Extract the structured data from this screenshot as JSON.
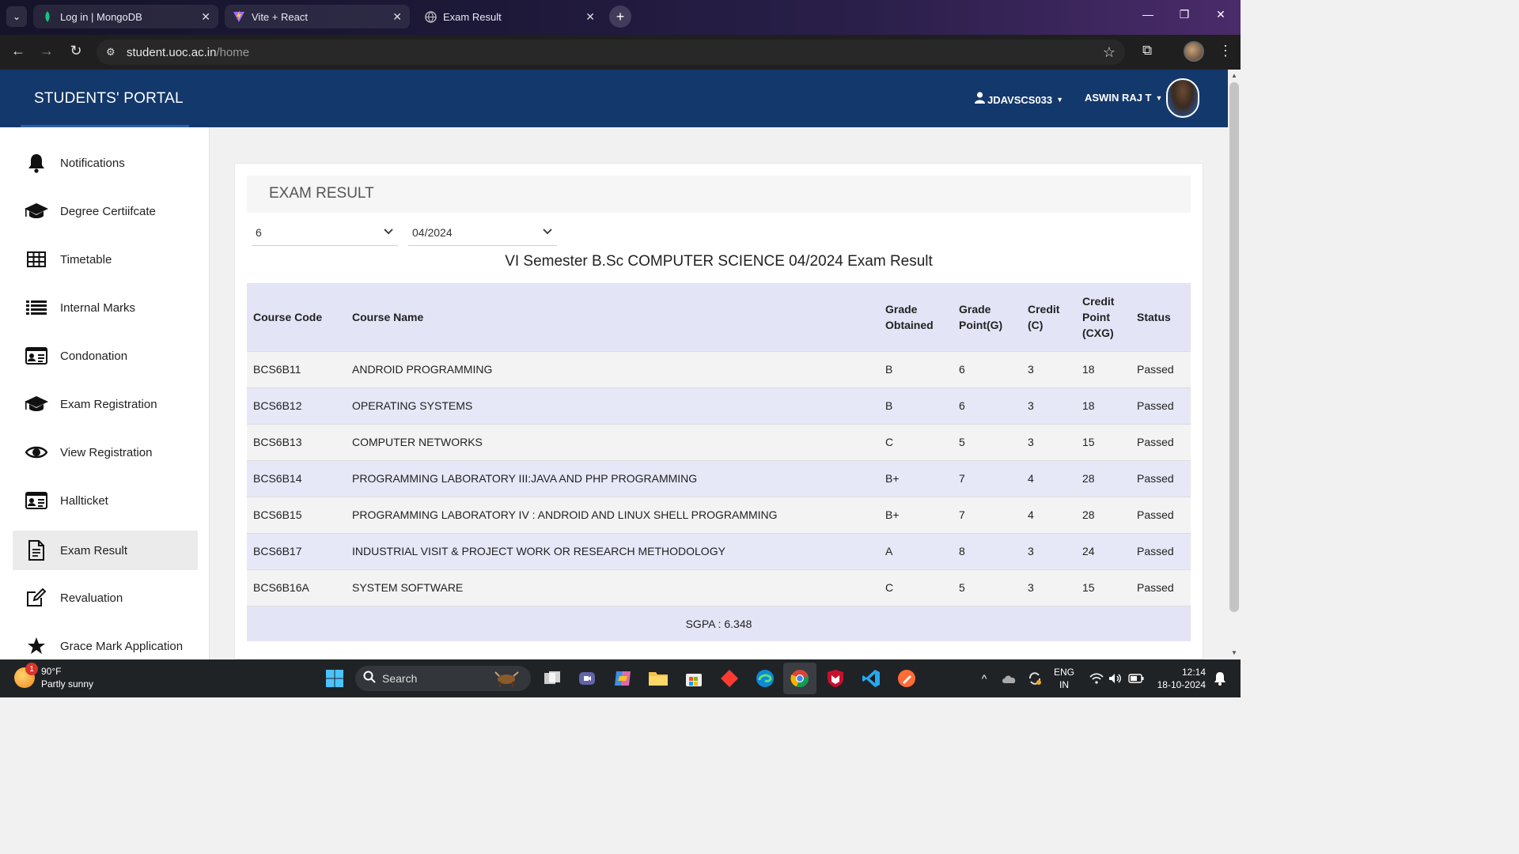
{
  "browser": {
    "tabs": [
      {
        "title": "Log in | MongoDB",
        "icon": "mongodb-leaf-icon",
        "active": false
      },
      {
        "title": "Vite + React",
        "icon": "vite-icon",
        "active": false
      },
      {
        "title": "Exam Result",
        "icon": "globe-icon",
        "active": true
      }
    ],
    "url_host": "student.uoc.ac.in",
    "url_path": "/home"
  },
  "header": {
    "brand": "STUDENTS' PORTAL",
    "user_id": "JDAVSCS033",
    "user_name": "ASWIN RAJ T",
    "brand_color": "#13386b"
  },
  "sidebar": {
    "items": [
      {
        "label": "Notifications",
        "icon": "bell-icon"
      },
      {
        "label": "Degree Certiifcate",
        "icon": "graduation-cap-icon"
      },
      {
        "label": "Timetable",
        "icon": "table-icon"
      },
      {
        "label": "Internal Marks",
        "icon": "list-icon"
      },
      {
        "label": "Condonation",
        "icon": "id-card-icon"
      },
      {
        "label": "Exam Registration",
        "icon": "graduation-cap-icon"
      },
      {
        "label": "View Registration",
        "icon": "eye-icon"
      },
      {
        "label": "Hallticket",
        "icon": "id-card-icon"
      },
      {
        "label": "Exam Result",
        "icon": "document-icon",
        "active": true
      },
      {
        "label": "Revaluation",
        "icon": "edit-icon"
      },
      {
        "label": "Grace Mark Application",
        "icon": "star-icon"
      }
    ]
  },
  "main": {
    "title": "EXAM RESULT",
    "semester_select": "6",
    "exam_select": "04/2024",
    "result_heading": "VI Semester B.Sc COMPUTER SCIENCE 04/2024 Exam Result",
    "columns": {
      "code": "Course Code",
      "name": "Course Name",
      "grade": [
        "Grade",
        "Obtained"
      ],
      "gp": [
        "Grade",
        "Point(G)"
      ],
      "credit": [
        "Credit",
        "(C)"
      ],
      "cp": [
        "Credit",
        "Point",
        "(CXG)"
      ],
      "status": "Status"
    },
    "rows": [
      {
        "code": "BCS6B11",
        "name": "ANDROID PROGRAMMING",
        "grade": "B",
        "gp": "6",
        "credit": "3",
        "cp": "18",
        "status": "Passed"
      },
      {
        "code": "BCS6B12",
        "name": "OPERATING SYSTEMS",
        "grade": "B",
        "gp": "6",
        "credit": "3",
        "cp": "18",
        "status": "Passed"
      },
      {
        "code": "BCS6B13",
        "name": "COMPUTER NETWORKS",
        "grade": "C",
        "gp": "5",
        "credit": "3",
        "cp": "15",
        "status": "Passed"
      },
      {
        "code": "BCS6B14",
        "name": "PROGRAMMING LABORATORY III:JAVA AND PHP PROGRAMMING",
        "grade": "B+",
        "gp": "7",
        "credit": "4",
        "cp": "28",
        "status": "Passed"
      },
      {
        "code": "BCS6B15",
        "name": "PROGRAMMING LABORATORY IV : ANDROID AND LINUX SHELL PROGRAMMING",
        "grade": "B+",
        "gp": "7",
        "credit": "4",
        "cp": "28",
        "status": "Passed"
      },
      {
        "code": "BCS6B17",
        "name": "INDUSTRIAL VISIT & PROJECT WORK OR RESEARCH METHODOLOGY",
        "grade": "A",
        "gp": "8",
        "credit": "3",
        "cp": "24",
        "status": "Passed"
      },
      {
        "code": "BCS6B16A",
        "name": "SYSTEM SOFTWARE",
        "grade": "C",
        "gp": "5",
        "credit": "3",
        "cp": "15",
        "status": "Passed"
      }
    ],
    "sgpa": "SGPA : 6.348"
  },
  "taskbar": {
    "weather_temp": "90°F",
    "weather_desc": "Partly sunny",
    "weather_badge": "1",
    "search_placeholder": "Search",
    "lang_line1": "ENG",
    "lang_line2": "IN",
    "time": "12:14",
    "date": "18-10-2024"
  }
}
